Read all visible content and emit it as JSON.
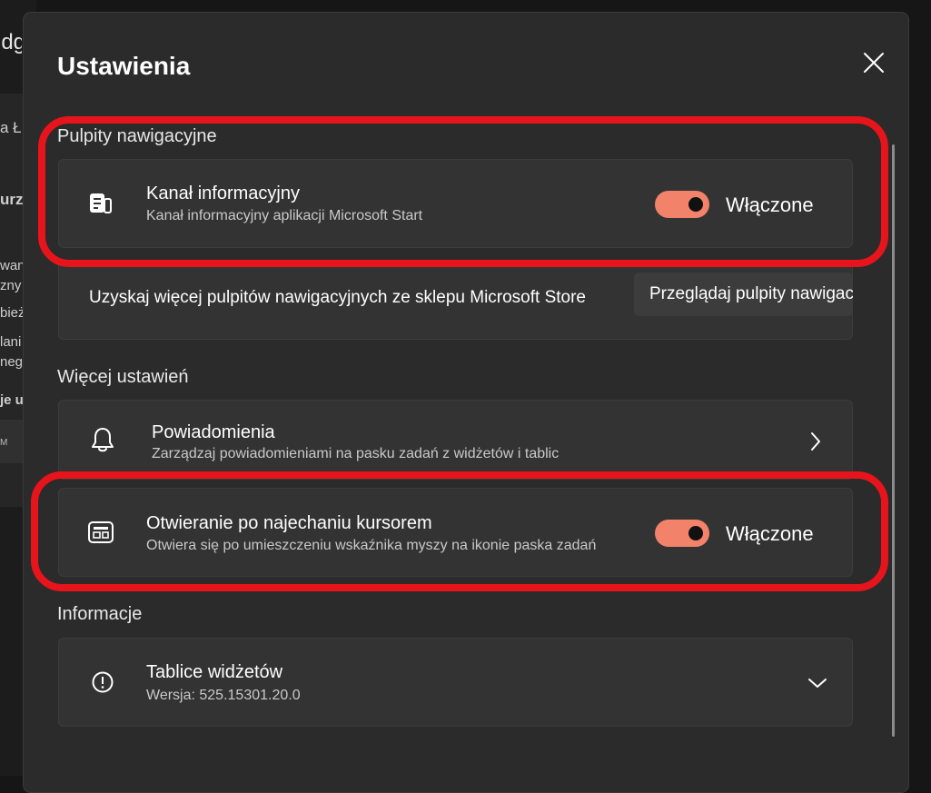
{
  "background": {
    "title_fragment": "idg",
    "line1": "a Ł",
    "line2": "urza",
    "line3": "wan",
    "line4": "zny",
    "line5": "bież",
    "line6": "lani",
    "line7": "negc",
    "line8": "je u",
    "row_text": "M"
  },
  "dialog": {
    "title": "Ustawienia",
    "close_icon": "close-icon"
  },
  "sections": {
    "dashboards": {
      "label": "Pulpity nawigacyjne",
      "feed": {
        "title": "Kanał informacyjny",
        "description": "Kanał informacyjny aplikacji Microsoft Start",
        "toggle_state": "Włączone",
        "toggle_on": true,
        "icon": "news-feed-icon"
      },
      "store": {
        "text": "Uzyskaj więcej pulpitów nawigacyjnych ze sklepu Microsoft Store",
        "button_label": "Przeglądaj pulpity nawigacyjne"
      }
    },
    "more_settings": {
      "label": "Więcej ustawień",
      "notifications": {
        "title": "Powiadomienia",
        "description": "Zarządzaj powiadomieniami na pasku zadań z widżetów i tablic",
        "icon": "bell-icon"
      },
      "hover_open": {
        "title": "Otwieranie po najechaniu kursorem",
        "description": "Otwiera się po umieszczeniu wskaźnika myszy na ikonie paska zadań",
        "toggle_state": "Włączone",
        "toggle_on": true,
        "icon": "widget-board-icon"
      }
    },
    "info": {
      "label": "Informacje",
      "boards": {
        "title": "Tablice widżetów",
        "version": "Wersja: 525.15301.20.0",
        "icon": "info-icon"
      }
    }
  },
  "colors": {
    "accent_toggle": "#f2826a",
    "highlight": "#e8141b",
    "dialog_bg": "#2b2b2b",
    "card_bg": "#333333"
  }
}
